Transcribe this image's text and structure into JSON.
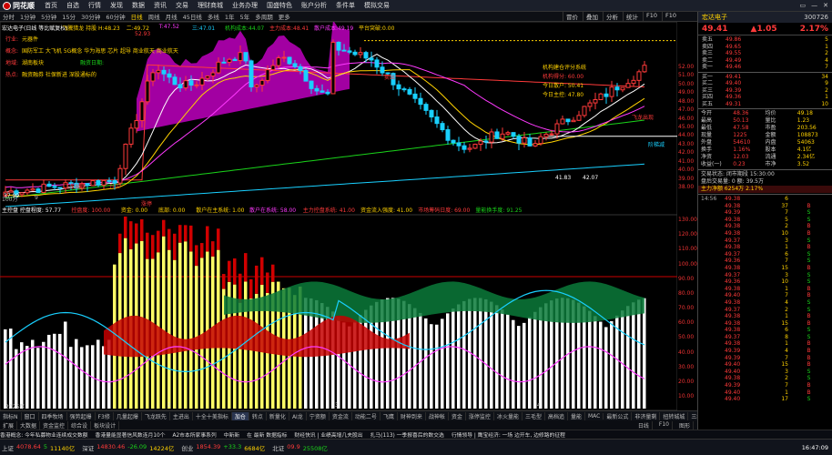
{
  "menu": {
    "logo": "同花顺",
    "items": [
      "首页",
      "自选",
      "行情",
      "发现",
      "数据",
      "资讯",
      "交易",
      "理财商城",
      "业务办理",
      "国盛特色",
      "账户分析",
      "条件单",
      "模拟交易"
    ],
    "window": [
      "▭",
      "—",
      "✕"
    ]
  },
  "timeframes": {
    "items": [
      "分时",
      "1分钟",
      "5分钟",
      "15分",
      "30分钟",
      "60分钟",
      "日线",
      "周线",
      "月线",
      "45日线",
      "多线",
      "1年",
      "5年",
      "多周期",
      "更多"
    ],
    "active": 6,
    "right": [
      "冒价",
      "叠加",
      "分析",
      "统计",
      "F10",
      "F10"
    ]
  },
  "stock": {
    "name": "宏达电子",
    "code": "300726",
    "price": "49.41",
    "change": "▲1.05",
    "pct": "2.17%"
  },
  "chart": {
    "main_header": [
      {
        "t": "宏达电子(日线 等比赋复权)",
        "c": "#ffffff"
      },
      {
        "t": "飞騰猎龙 持股 H:48.23",
        "c": "#ffd200"
      },
      {
        "t": "二:49.72",
        "c": "#ffd200"
      },
      {
        "t": "T:47.52",
        "c": "#ff3aff"
      },
      {
        "t": "三:47.01",
        "c": "#19d0ff"
      },
      {
        "t": "机构成本:44.07",
        "c": "#1ad31a"
      },
      {
        "t": "主力成本:48.41",
        "c": "#ff3a3a"
      },
      {
        "t": "散户成本:49.19",
        "c": "#ff3aff"
      },
      {
        "t": "平台突破:0.00",
        "c": "#ffd200"
      }
    ],
    "info_lines": [
      {
        "k": "行业:",
        "v": "元器件"
      },
      {
        "k": "概念:",
        "v": "国防军工 大飞机 5G概念 华为海思 芯片 超导 商业航天 商业航天"
      },
      {
        "k": "地域:",
        "v": "湖南板块",
        "extra": "融资日期:"
      },
      {
        "k": "热点:",
        "v": "融资融券 社保新进 深股通标的"
      }
    ],
    "panel_box": [
      "机构建仓评分系统",
      "机构得分: 60.00",
      "今日散户: 50.41",
      "今日主控: 47.80"
    ],
    "high_label": "52.93",
    "low_label": "37.99",
    "low_label2": "41.83",
    "low_label3": "42.07",
    "annotations": [
      "飞龙出现",
      "升买",
      "卖出",
      "飞龙出现",
      "阶梯减"
    ],
    "main_yaxis": [
      "52.00",
      "51.00",
      "50.00",
      "49.00",
      "48.00",
      "47.00",
      "46.00",
      "45.00",
      "44.00",
      "43.00",
      "42.00",
      "41.00",
      "40.00",
      "39.00",
      "38.00"
    ],
    "sub_header": [
      {
        "t": "主控盘  控盘程度: 57.77",
        "c": "#ffffff"
      },
      {
        "t": "控盘度: 100.00",
        "c": "#ff3a3a"
      },
      {
        "t": "资金: 0.00",
        "c": "#ffd200"
      },
      {
        "t": "底部: 0.00",
        "c": "#ffd200"
      },
      {
        "t": "散户在主系统: 1.00",
        "c": "#ffd200"
      },
      {
        "t": "散户在系统: 58.00",
        "c": "#ff3aff"
      },
      {
        "t": "主力控盘系统: 41.00",
        "c": "#ff3a3a"
      },
      {
        "t": "资金流入强度: 41.00",
        "c": "#ffd200"
      },
      {
        "t": "市场筹码日度: 69.00",
        "c": "#ff3a3a"
      },
      {
        "t": "量能换手度: 91.25",
        "c": "#1ad31a"
      }
    ],
    "sub_yaxis": [
      "130.00",
      "120.00",
      "110.00",
      "100.00",
      "90.00",
      "80.00",
      "70.00",
      "60.00",
      "50.00",
      "40.00",
      "30.00",
      "20.00",
      "10.00"
    ],
    "x_labels": [
      "2025年",
      "2",
      "3",
      "4"
    ],
    "small_marks": [
      "100万",
      "9",
      "涨停"
    ]
  },
  "orderbook": {
    "sells": [
      [
        "卖五",
        "49.86",
        "5"
      ],
      [
        "卖四",
        "49.65",
        "1"
      ],
      [
        "卖三",
        "49.55",
        "2"
      ],
      [
        "卖二",
        "49.49",
        "4"
      ],
      [
        "卖一",
        "49.46",
        "7"
      ]
    ],
    "buys": [
      [
        "买一",
        "49.41",
        "34"
      ],
      [
        "买二",
        "49.40",
        "9"
      ],
      [
        "买三",
        "49.39",
        "2"
      ],
      [
        "买四",
        "49.36",
        "1"
      ],
      [
        "买五",
        "49.31",
        "10"
      ]
    ]
  },
  "stats": [
    [
      [
        "今开",
        "48.36"
      ],
      [
        "均价",
        "49.18"
      ]
    ],
    [
      [
        "最高",
        "50.13"
      ],
      [
        "量比",
        "1.23"
      ]
    ],
    [
      [
        "最低",
        "47.58"
      ],
      [
        "市盈",
        "203.56"
      ]
    ],
    [
      [
        "现量",
        "1225"
      ],
      [
        "金额",
        "108873"
      ]
    ],
    [
      [
        "外盘",
        "54610"
      ],
      [
        "内盘",
        "54063"
      ]
    ],
    [
      [
        "换手",
        "1.16%"
      ],
      [
        "股本",
        "4.1亿"
      ]
    ],
    [
      [
        "净资",
        "12.03"
      ],
      [
        "流通",
        "2.34亿"
      ]
    ],
    [
      [
        "收益(一)",
        "0.23"
      ],
      [
        "市净",
        "3.52"
      ]
    ]
  ],
  "stats2": [
    "交易状态: 闭市期段 15:30:00",
    "盘后交易量: 0 额: 39.5万",
    "主力净额  6254万  2.17%"
  ],
  "trades": [
    [
      "14:56",
      "49.38",
      "6",
      ""
    ],
    [
      "",
      "49.38",
      "37",
      "B"
    ],
    [
      "",
      "49.39",
      "7",
      "S"
    ],
    [
      "",
      "49.38",
      "5",
      "S"
    ],
    [
      "",
      "49.38",
      "2",
      "B"
    ],
    [
      "",
      "49.38",
      "10",
      "B"
    ],
    [
      "",
      "49.37",
      "3",
      "S"
    ],
    [
      "",
      "49.38",
      "1",
      "B"
    ],
    [
      "",
      "49.37",
      "6",
      "S"
    ],
    [
      "",
      "49.36",
      "7",
      "S"
    ],
    [
      "",
      "49.38",
      "15",
      "B"
    ],
    [
      "",
      "49.37",
      "3",
      "S"
    ],
    [
      "",
      "49.36",
      "10",
      "S"
    ],
    [
      "",
      "49.38",
      "1",
      "B"
    ],
    [
      "",
      "49.40",
      "7",
      "B"
    ],
    [
      "",
      "49.38",
      "4",
      "S"
    ],
    [
      "",
      "49.37",
      "2",
      "S"
    ],
    [
      "",
      "49.38",
      "1",
      "B"
    ],
    [
      "",
      "49.38",
      "15",
      "B"
    ],
    [
      "",
      "49.38",
      "6",
      "S"
    ],
    [
      "",
      "49.37",
      "8",
      "S"
    ],
    [
      "",
      "49.38",
      "1",
      "B"
    ],
    [
      "",
      "49.39",
      "4",
      "B"
    ],
    [
      "",
      "49.39",
      "7",
      "B"
    ],
    [
      "",
      "49.40",
      "15",
      "B"
    ],
    [
      "",
      "49.40",
      "3",
      "S"
    ],
    [
      "",
      "49.38",
      "2",
      "S"
    ],
    [
      "",
      "49.39",
      "7",
      "B"
    ],
    [
      "",
      "49.40",
      "1",
      "B"
    ],
    [
      "",
      "49.40",
      "17",
      "S"
    ],
    [
      "14:57",
      "49.40",
      "7",
      "B"
    ],
    [
      "",
      "49.40",
      "19",
      "B"
    ],
    [
      "",
      "49.41",
      "2",
      "B"
    ],
    [
      "",
      "49.41",
      "1",
      "P"
    ],
    [
      "15:00",
      "49.41",
      "1225",
      "B"
    ]
  ],
  "bottom_tabs": [
    "指标N",
    "窗口",
    "四季牧场",
    "强势起爆",
    "F3修",
    "几量起爆",
    "飞龙跃先",
    "主进出",
    "十全十美指标",
    "加仓",
    "转点",
    "新量化",
    "AI龙",
    "宁资额",
    "资金流",
    "动能二号",
    "飞鹰",
    "财神到来",
    "战神帐",
    "资金",
    "涨停监控",
    "冰火量能",
    "三毛型",
    "高档追",
    "量能",
    "MAC",
    "最新公式",
    "非济量剩",
    "扭转城城",
    "三维一体"
  ],
  "bottom_tabs2": [
    "扩展",
    "大数据",
    "资金监控",
    "综合设",
    "板块设计"
  ],
  "right_bottom": [
    "日线",
    "F10",
    "图形"
  ],
  "ticker": [
    "香港概念: 今年私募物业连续成交数额",
    "香港量能显著信风数连月10个",
    "A2市本所家事系列",
    "中新新",
    "在 最新 数据指标",
    "财经快讯 | 业绩高增几夫股出",
    "扎马(113) 一季报喜后的数交选",
    "行情领导 | 鹰宝经济: 一场 边开车, 边修路的征程"
  ],
  "status": [
    [
      "上证",
      "4078.64",
      "5",
      "11140亿"
    ],
    [
      "深证",
      "14830.46",
      "-26.09",
      "14224亿"
    ],
    [
      "创业",
      "1854.39",
      "+33.3",
      "6684亿"
    ],
    [
      "北证",
      "09.9",
      "25508亿",
      ""
    ]
  ],
  "clock": "16:47:09"
}
